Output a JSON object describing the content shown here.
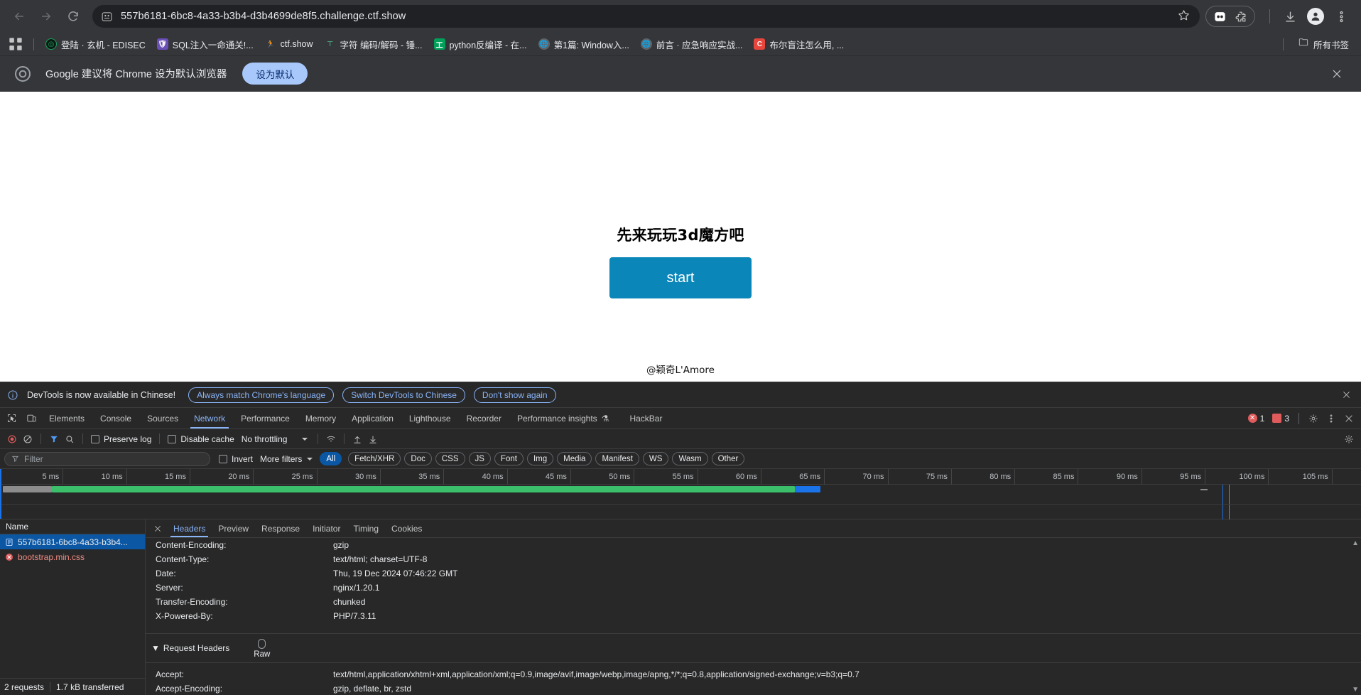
{
  "browser": {
    "url": "557b6181-6bc8-4a33-b3b4-d3b4699de8f5.challenge.ctf.show",
    "nav": {
      "back": "back-arrow",
      "forward": "forward-arrow",
      "reload": "reload"
    },
    "bookmarks": [
      {
        "label": "登陆 · 玄机 - EDISEC",
        "icon": "globe",
        "color": "#1aa260"
      },
      {
        "label": "SQL注入一命通关!...",
        "icon": "shield",
        "color": "#6b4fb8"
      },
      {
        "label": "ctf.show",
        "icon": "runner",
        "color": "#444444"
      },
      {
        "label": "字符 编码/解码 - 锤...",
        "icon": "tool",
        "color": "#4a9e7a"
      },
      {
        "label": "python反编译 - 在...",
        "icon": "letter",
        "color": "#00a05a"
      },
      {
        "label": "第1篇: Window入...",
        "icon": "globe",
        "color": "#5f6368"
      },
      {
        "label": "前言 · 应急响应实战...",
        "icon": "globe",
        "color": "#5f6368"
      },
      {
        "label": "布尔盲注怎么用, ...",
        "icon": "letter-c",
        "color": "#e8453c"
      }
    ],
    "all_bookmarks_label": "所有书签"
  },
  "promo": {
    "text": "Google 建议将 Chrome 设为默认浏览器",
    "button": "设为默认"
  },
  "page": {
    "title": "先来玩玩3d魔方吧",
    "start_button": "start",
    "credit": "@颖奇L'Amore"
  },
  "devtools": {
    "banner": {
      "message": "DevTools is now available in Chinese!",
      "buttons": [
        "Always match Chrome's language",
        "Switch DevTools to Chinese",
        "Don't show again"
      ]
    },
    "tabs": [
      "Elements",
      "Console",
      "Sources",
      "Network",
      "Performance",
      "Memory",
      "Application",
      "Lighthouse",
      "Recorder",
      "Performance insights",
      "HackBar"
    ],
    "active_tab": "Network",
    "counters": {
      "errors": "1",
      "warnings": "3"
    },
    "network_toolbar": {
      "preserve_log": "Preserve log",
      "disable_cache": "Disable cache",
      "throttling": "No throttling"
    },
    "filter_bar": {
      "placeholder": "Filter",
      "invert": "Invert",
      "more_filters": "More filters",
      "types": [
        "All",
        "Fetch/XHR",
        "Doc",
        "CSS",
        "JS",
        "Font",
        "Img",
        "Media",
        "Manifest",
        "WS",
        "Wasm",
        "Other"
      ],
      "active_type": "All"
    },
    "timeline": {
      "ticks": [
        "5 ms",
        "10 ms",
        "15 ms",
        "20 ms",
        "25 ms",
        "30 ms",
        "35 ms",
        "40 ms",
        "45 ms",
        "50 ms",
        "55 ms",
        "60 ms",
        "65 ms",
        "70 ms",
        "75 ms",
        "80 ms",
        "85 ms",
        "90 ms",
        "95 ms",
        "100 ms",
        "105 ms"
      ],
      "bars": [
        {
          "name": "document-request",
          "start_pct": 0.2,
          "width_pct": 3.6,
          "color": "#8c8c8c"
        },
        {
          "name": "document-response",
          "start_pct": 3.8,
          "width_pct": 54.6,
          "color": "#3bbf6b"
        },
        {
          "name": "css-request",
          "start_pct": 58.4,
          "width_pct": 1.9,
          "color": "#1a73e8"
        }
      ],
      "markers": [
        {
          "name": "dom-content-loaded",
          "pct": 89.8,
          "color": "#1a73e8"
        },
        {
          "name": "load-event",
          "pct": 90.3,
          "color": "#e05b5b"
        }
      ]
    },
    "requests": {
      "column_header": "Name",
      "rows": [
        {
          "name": "557b6181-6bc8-4a33-b3b4...",
          "icon": "document-icon",
          "selected": true
        },
        {
          "name": "bootstrap.min.css",
          "icon": "error-icon",
          "selected": false
        }
      ],
      "footer": {
        "count": "2 requests",
        "transferred": "1.7 kB transferred"
      }
    },
    "detail": {
      "tabs": [
        "Headers",
        "Preview",
        "Response",
        "Initiator",
        "Timing",
        "Cookies"
      ],
      "active_tab": "Headers",
      "response_headers": [
        {
          "key": "Content-Encoding:",
          "value": "gzip"
        },
        {
          "key": "Content-Type:",
          "value": "text/html; charset=UTF-8"
        },
        {
          "key": "Date:",
          "value": "Thu, 19 Dec 2024 07:46:22 GMT"
        },
        {
          "key": "Server:",
          "value": "nginx/1.20.1"
        },
        {
          "key": "Transfer-Encoding:",
          "value": "chunked"
        },
        {
          "key": "X-Powered-By:",
          "value": "PHP/7.3.11"
        }
      ],
      "request_section_title": "Request Headers",
      "raw_label": "Raw",
      "request_headers": [
        {
          "key": "Accept:",
          "value": "text/html,application/xhtml+xml,application/xml;q=0.9,image/avif,image/webp,image/apng,*/*;q=0.8,application/signed-exchange;v=b3;q=0.7"
        },
        {
          "key": "Accept-Encoding:",
          "value": "gzip, deflate, br, zstd"
        }
      ]
    }
  }
}
